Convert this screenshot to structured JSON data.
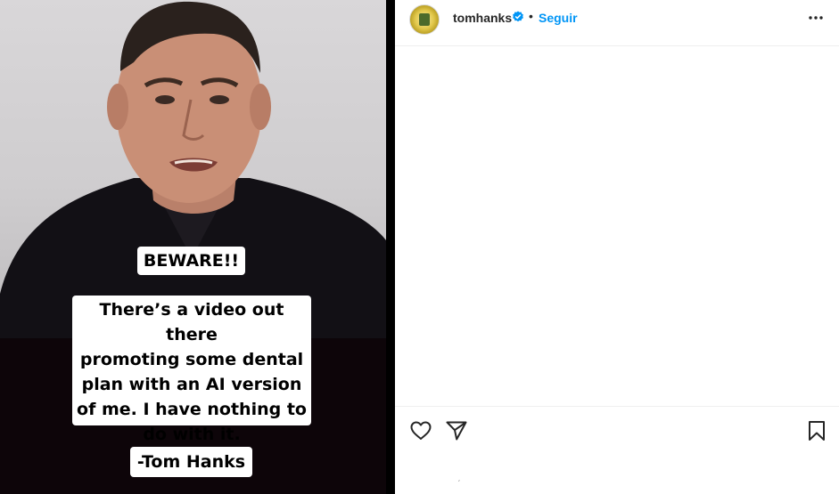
{
  "post": {
    "username": "tomhanks",
    "separator": "•",
    "follow_label": "Seguir",
    "verified_icon": "verified-badge-icon",
    "more_icon": "more-options-icon"
  },
  "media": {
    "caption_beware": "BEWARE!!",
    "caption_main": "There’s a video out there\npromoting some dental\nplan with an AI version\nof me.  I have nothing to\ndo with it.",
    "caption_signature": "-Tom Hanks"
  },
  "actions": {
    "like_icon": "heart-icon",
    "share_icon": "send-icon",
    "save_icon": "bookmark-icon",
    "tiny_mark": "ˏ"
  },
  "colors": {
    "accent": "#0095f6",
    "text": "#262626",
    "verified": "#0095f6"
  }
}
